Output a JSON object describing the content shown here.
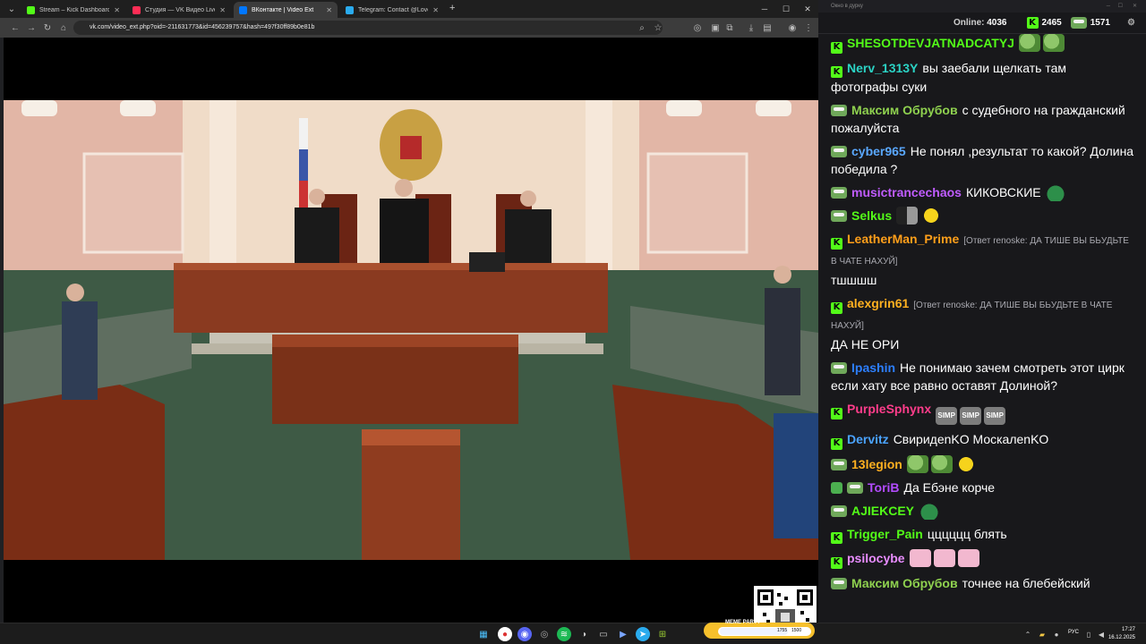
{
  "browser": {
    "tabs": [
      {
        "title": "Stream – Kick Dashboard",
        "color": "#53fc18",
        "active": false
      },
      {
        "title": "Студия — VK Видео Live",
        "color": "#ff2d55",
        "active": false
      },
      {
        "title": "ВКонтакте | Video Ext",
        "color": "#0077ff",
        "active": true
      },
      {
        "title": "Telegram: Contact @Love_Rus...",
        "color": "#2aabee",
        "active": false
      }
    ],
    "new_tab": "+",
    "url": "vk.com/video_ext.php?oid=-211631773&id=456239757&hash=497f30ff89b0e81b"
  },
  "chat": {
    "window_title": "Окно в дурку",
    "online_label": "Online:",
    "online_count": "4036",
    "kick_count": "2465",
    "pepe_count": "1571",
    "messages": [
      {
        "user": "SHESOTDEVJATNADCATYJ",
        "color": "#53fc18",
        "badge": "kick",
        "text": "",
        "emotes": [
          "frog",
          "frog"
        ]
      },
      {
        "user": "Nerv_1313Y",
        "color": "#2bd3c5",
        "badge": "kick",
        "text": "вы заебали щелкать там фотографы суки",
        "emotes": []
      },
      {
        "user": "Максим Обрубов",
        "color": "#8fd14f",
        "badge": "pepe",
        "text": "с судебного на гражданский пожалуйста",
        "emotes": []
      },
      {
        "user": "cyber965",
        "color": "#5aa8ff",
        "badge": "pepe",
        "text": "Не понял ,результат то какой? Долина победила ?",
        "emotes": []
      },
      {
        "user": "musictrancechaos",
        "color": "#c05cff",
        "badge": "pepe",
        "text": "КИКОВСКИЕ",
        "emotes": [
          "blob"
        ]
      },
      {
        "user": "Selkus",
        "color": "#53fc18",
        "badge": "pepe",
        "text": "",
        "emotes": [
          "dark",
          "yellow"
        ]
      },
      {
        "user": "LeatherMan_Prime",
        "color": "#ff9f1a",
        "badge": "kick",
        "reply": "[Ответ renoske: ДА ТИШЕ ВЫ БЬУДЬТЕ В ЧАТЕ НАХУЙ]",
        "text": "тшшшш",
        "emotes": []
      },
      {
        "user": "alexgrin61",
        "color": "#ffb020",
        "badge": "kick",
        "reply": "[Ответ renoske: ДА ТИШЕ ВЫ БЬУДЬТЕ В ЧАТЕ НАХУЙ]",
        "text": "ДА НЕ ОРИ",
        "emotes": []
      },
      {
        "user": "Ipashin",
        "color": "#2d7fff",
        "badge": "pepe",
        "text": "Не понимаю зачем смотреть этот цирк если хату все равно оставят Долиной?",
        "emotes": []
      },
      {
        "user": "PurpleSphynx",
        "color": "#ff3d8b",
        "badge": "kick",
        "text": "",
        "emotes": [
          "simp",
          "simp",
          "simp"
        ]
      },
      {
        "user": "Dervitz",
        "color": "#4aa3ff",
        "badge": "kick",
        "text": "СвиридenKO МоскалenKO",
        "emotes": []
      },
      {
        "user": "13legion",
        "color": "#ffb020",
        "badge": "pepe",
        "text": "",
        "emotes": [
          "frog",
          "frog",
          "yellow"
        ]
      },
      {
        "user": "ToriB",
        "color": "#b34cff",
        "badge": "shield",
        "text": "Да Ебэне корче",
        "emotes": []
      },
      {
        "user": "AJIEKCEY",
        "color": "#53fc18",
        "badge": "pepe",
        "text": "",
        "emotes": [
          "blob"
        ]
      },
      {
        "user": "Trigger_Pain",
        "color": "#53fc18",
        "badge": "kick",
        "text": "цццццц блять",
        "emotes": []
      },
      {
        "user": "psilocybe",
        "color": "#e88cff",
        "badge": "kick",
        "text": "",
        "emotes": [
          "pink",
          "pink",
          "pink"
        ]
      },
      {
        "user": "Максим Обрубов",
        "color": "#8fd14f",
        "badge": "pepe",
        "text": "точнее на блебейский",
        "emotes": []
      }
    ]
  },
  "taskbar": {
    "lang": "РУС",
    "time": "17:27",
    "date": "16.12.2025",
    "meme_party": "MEME PARTY",
    "meme_left": "1755",
    "meme_right": "1500"
  }
}
